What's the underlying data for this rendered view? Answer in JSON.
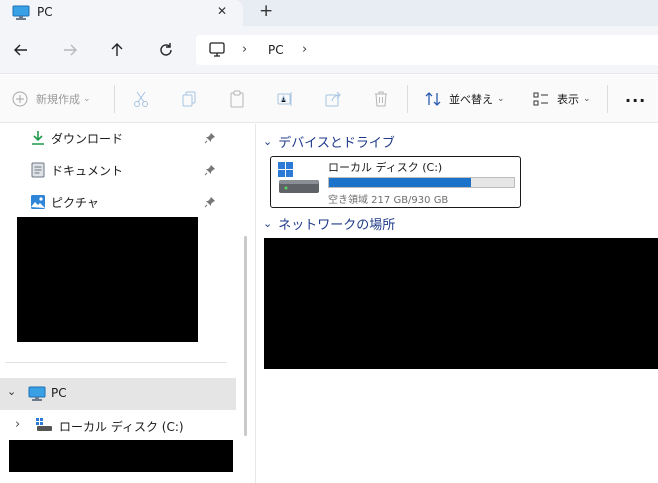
{
  "tab": {
    "title": "PC",
    "close": "✕",
    "new": "+"
  },
  "address": {
    "location": "PC"
  },
  "toolbar": {
    "new_label": "新規作成",
    "sort_label": "並べ替え",
    "view_label": "表示",
    "more": "..."
  },
  "nav": {
    "quick": [
      {
        "label": "ダウンロード"
      },
      {
        "label": "ドキュメント"
      },
      {
        "label": "ピクチャ"
      }
    ],
    "pc_label": "PC",
    "drive_label": "ローカル ディスク (C:)"
  },
  "main": {
    "devices_header": "デバイスとドライブ",
    "drive": {
      "name": "ローカル ディスク (C:)",
      "free_text": "空き領域 217 GB/930 GB",
      "used_fraction": 0.767
    },
    "network_header": "ネットワークの場所"
  }
}
